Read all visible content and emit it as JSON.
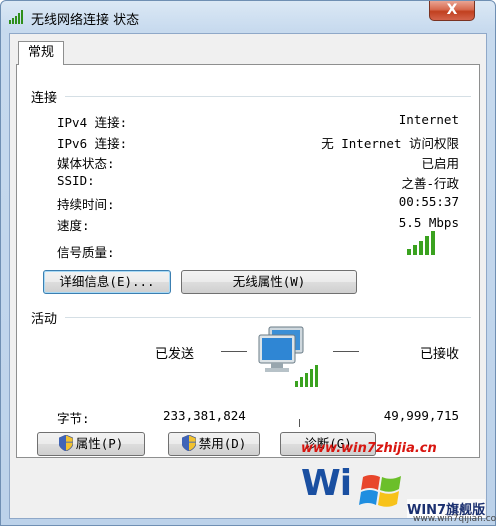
{
  "window": {
    "title": "无线网络连接 状态",
    "close_label": "X"
  },
  "tab": {
    "label": "常规"
  },
  "connection": {
    "group_title": "连接",
    "rows": [
      {
        "label": "IPv4 连接:",
        "value": "Internet"
      },
      {
        "label": "IPv6 连接:",
        "value": "无 Internet 访问权限"
      },
      {
        "label": "媒体状态:",
        "value": "已启用"
      },
      {
        "label": "SSID:",
        "value": "之善-行政"
      },
      {
        "label": "持续时间:",
        "value": "00:55:37"
      },
      {
        "label": "速度:",
        "value": "5.5 Mbps"
      }
    ],
    "signal_label": "信号质量:",
    "signal_icon": "signal-bars-icon",
    "details_button": "详细信息(E)...",
    "wireless_props_button": "无线属性(W)"
  },
  "activity": {
    "group_title": "活动",
    "sent_label": "已发送",
    "received_label": "已接收",
    "bytes_label": "字节:",
    "bytes_sent": "233,381,824",
    "bytes_received": "49,999,715",
    "network_icon": "network-computers-icon"
  },
  "buttons": {
    "properties": "属性(P)",
    "disable": "禁用(D)",
    "diagnose": "诊断(G)"
  },
  "watermark": {
    "url": "www.win7zhijia.cn",
    "big_text": "Wi",
    "brand": "WIN7旗舰版",
    "small": "www.win7qijian.com"
  },
  "colors": {
    "accent": "#1a4fa1",
    "signal": "#3aa21f",
    "close": "#c1401f"
  }
}
